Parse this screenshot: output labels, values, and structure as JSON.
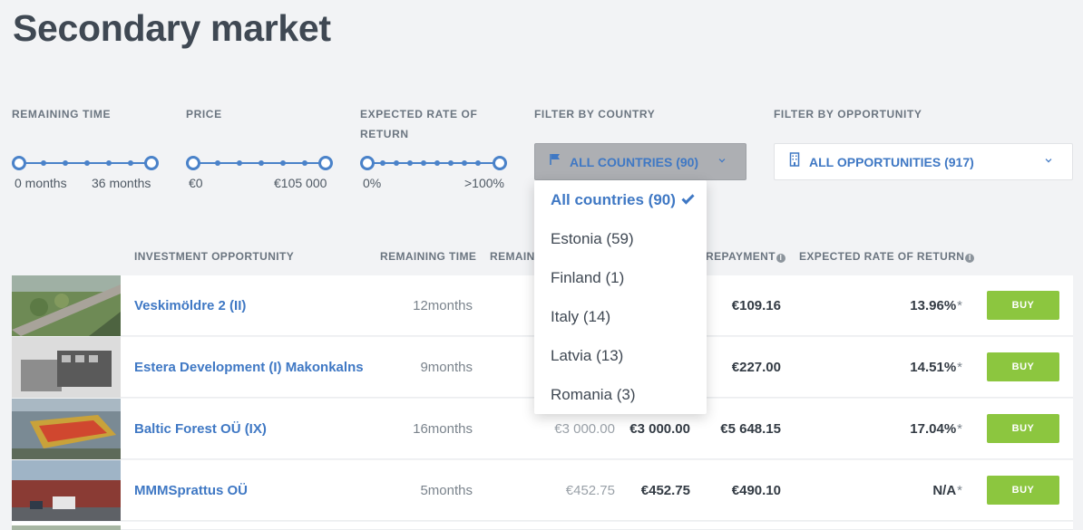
{
  "page": {
    "title": "Secondary market"
  },
  "filters": {
    "remaining_time": {
      "label": "REMAINING TIME",
      "min": "0 months",
      "max": "36 months"
    },
    "price": {
      "label": "PRICE",
      "min": "€0",
      "max": "€105 000"
    },
    "rate": {
      "label_line1": "EXPECTED RATE OF",
      "label_line2": "RETURN",
      "min": "0%",
      "max": ">100%"
    },
    "country": {
      "label": "FILTER BY COUNTRY",
      "selected": "ALL COUNTRIES (90)",
      "icon": "flag-icon"
    },
    "opportunity": {
      "label": "FILTER BY OPPORTUNITY",
      "selected": "ALL OPPORTUNITIES (917)",
      "icon": "building-icon"
    }
  },
  "country_dropdown": {
    "options": [
      "All countries (90)",
      "Estonia (59)",
      "Finland (1)",
      "Italy (14)",
      "Latvia (13)",
      "Romania (3)"
    ]
  },
  "table": {
    "headers": {
      "opportunity": "INVESTMENT OPPORTUNITY",
      "remaining_time": "REMAINING TIME",
      "remaining_partial": "REMAIN",
      "repayment_partial": "REPAYMENT",
      "rate": "EXPECTED RATE OF RETURN"
    },
    "buy_label": "BUY",
    "rows": [
      {
        "name": "Veskimöldre 2 (II)",
        "time": "12months",
        "rem": "",
        "price": "",
        "repay": "€109.16",
        "rate": "13.96%"
      },
      {
        "name": "Estera Development (I) Makonkalns",
        "time": "9months",
        "rem": "",
        "price": "",
        "repay": "€227.00",
        "rate": "14.51%"
      },
      {
        "name": "Baltic Forest OÜ (IX)",
        "time": "16months",
        "rem": "€3 000.00",
        "price": "€3 000.00",
        "repay": "€5 648.15",
        "rate": "17.04%"
      },
      {
        "name": "MMMSprattus OÜ",
        "time": "5months",
        "rem": "€452.75",
        "price": "€452.75",
        "repay": "€490.10",
        "rate": "N/A"
      }
    ],
    "rate_suffix": "*"
  },
  "colors": {
    "accent": "#3f78c4",
    "buy": "#8cc63f"
  }
}
